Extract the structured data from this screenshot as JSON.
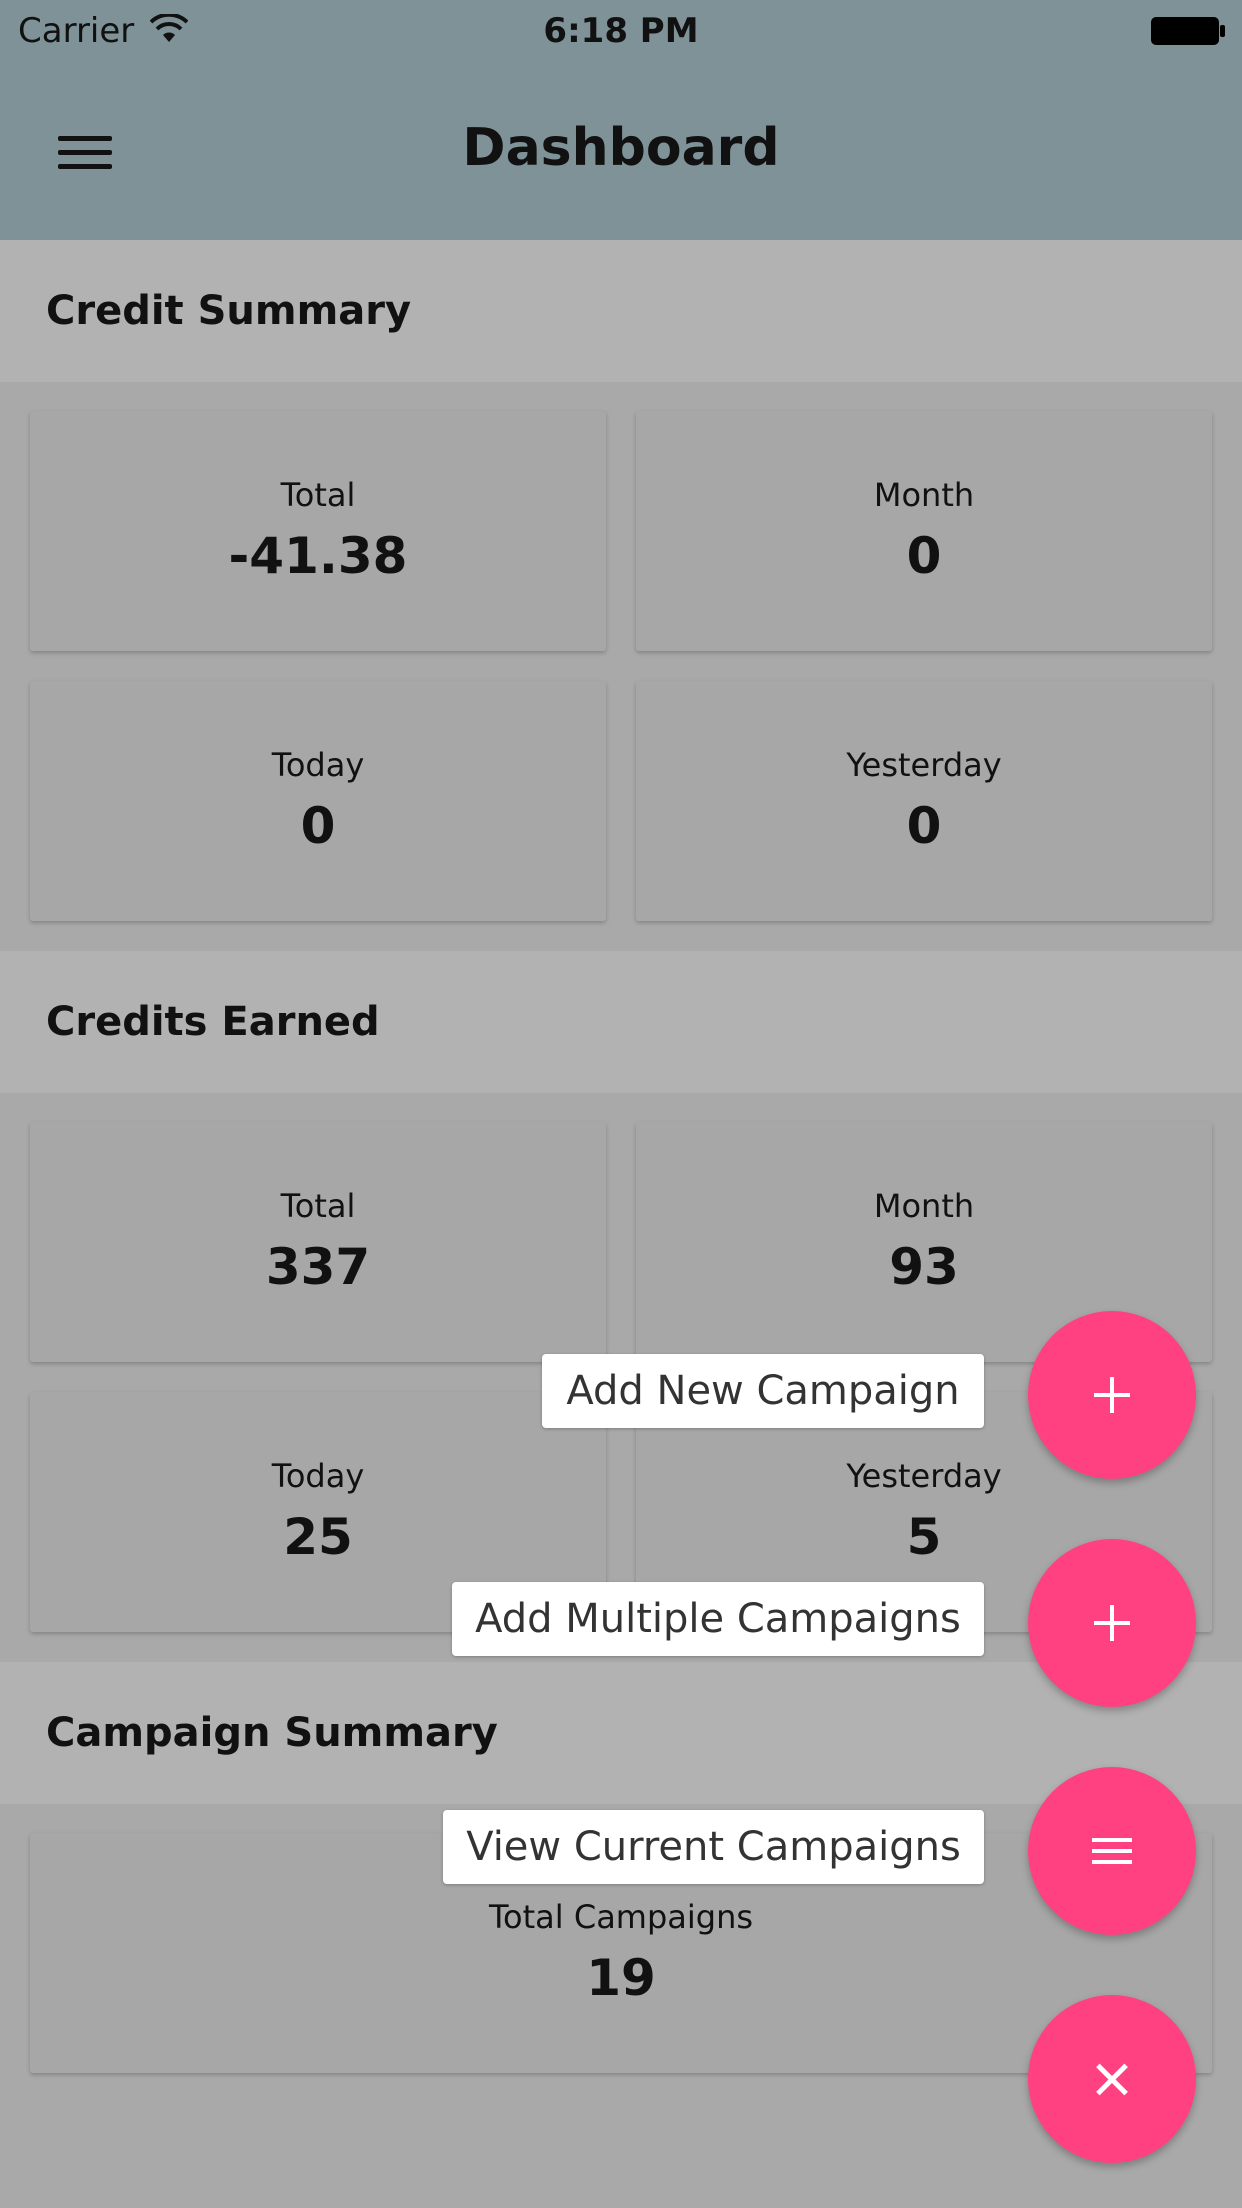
{
  "status_bar": {
    "carrier": "Carrier",
    "time": "6:18 PM"
  },
  "header": {
    "title": "Dashboard"
  },
  "credit_summary": {
    "title": "Credit Summary",
    "cards": [
      {
        "label": "Total",
        "value": "-41.38"
      },
      {
        "label": "Month",
        "value": "0"
      },
      {
        "label": "Today",
        "value": "0"
      },
      {
        "label": "Yesterday",
        "value": "0"
      }
    ]
  },
  "credits_earned": {
    "title": "Credits Earned",
    "cards": [
      {
        "label": "Total",
        "value": "337"
      },
      {
        "label": "Month",
        "value": "93"
      },
      {
        "label": "Today",
        "value": "25"
      },
      {
        "label": "Yesterday",
        "value": "5"
      }
    ]
  },
  "campaign_summary": {
    "title": "Campaign Summary",
    "cards": [
      {
        "label": "Total Campaigns",
        "value": "19"
      }
    ]
  },
  "fab_menu": {
    "add_new_label": "Add New Campaign",
    "add_multiple_label": "Add Multiple Campaigns",
    "view_current_label": "View Current Campaigns",
    "accent_color": "#ff4081"
  },
  "icons": {
    "menu": "hamburger-menu-icon",
    "add": "plus-icon",
    "list": "list-icon",
    "close": "close-icon"
  }
}
